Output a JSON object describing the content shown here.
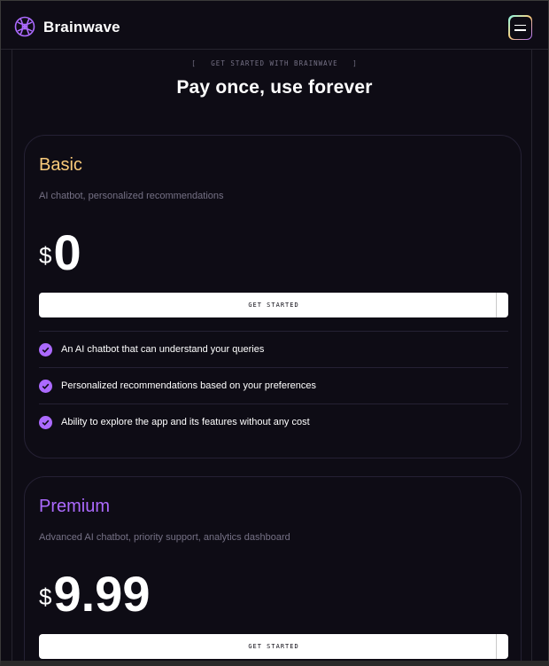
{
  "header": {
    "brand": "Brainwave",
    "menu_icon": "menu-icon",
    "accent": "#ac6aff"
  },
  "section": {
    "eyebrow_open": "[",
    "eyebrow": "GET STARTED WITH BRAINWAVE",
    "eyebrow_close": "]",
    "title": "Pay once, use forever"
  },
  "plans": [
    {
      "name": "Basic",
      "color": "#facb7b",
      "description": "AI chatbot, personalized recommendations",
      "currency": "$",
      "price": "0",
      "cta": "GET STARTED",
      "features": [
        "An AI chatbot that can understand your queries",
        "Personalized recommendations based on your preferences",
        "Ability to explore the app and its features without any cost"
      ]
    },
    {
      "name": "Premium",
      "color": "#ac6aff",
      "description": "Advanced AI chatbot, priority support, analytics dashboard",
      "currency": "$",
      "price": "9.99",
      "cta": "GET STARTED"
    }
  ],
  "check_color": "#ac6aff"
}
